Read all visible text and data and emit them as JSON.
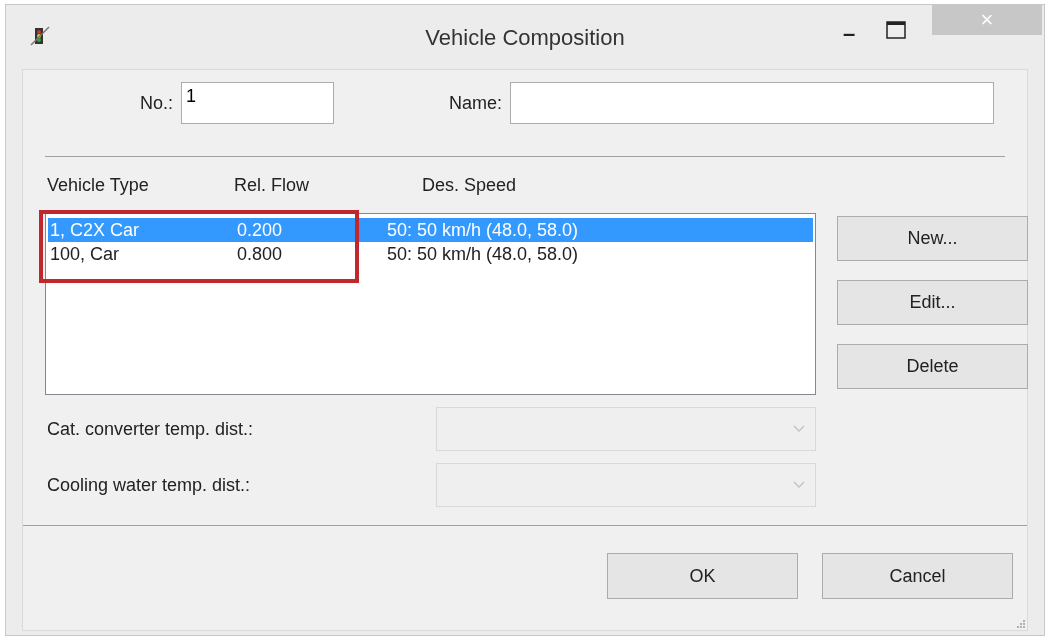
{
  "window": {
    "title": "Vehicle Composition",
    "controls": [
      "–",
      "×"
    ]
  },
  "fields": {
    "no_label": "No.:",
    "no_value": "1",
    "name_label": "Name:"
  },
  "table": {
    "columns": [
      "Vehicle Type",
      "Rel. Flow",
      "Des. Speed"
    ],
    "rows": [
      {
        "cells": [
          "1, C2X Car",
          "0.200",
          "50: 50 km/h (48.0, 58.0)"
        ],
        "selected": true
      },
      {
        "cells": [
          "100, Car",
          "0.800",
          "50: 50 km/h (48.0, 58.0)"
        ],
        "selected": false
      }
    ]
  },
  "side_buttons": [
    "New...",
    "Edit...",
    "Delete"
  ],
  "dropdowns": [
    {
      "label": "Cat. converter temp. dist.:",
      "disabled": true
    },
    {
      "label": "Cooling water temp. dist.:",
      "disabled": true
    }
  ],
  "buttons": [
    "OK",
    "Cancel"
  ]
}
